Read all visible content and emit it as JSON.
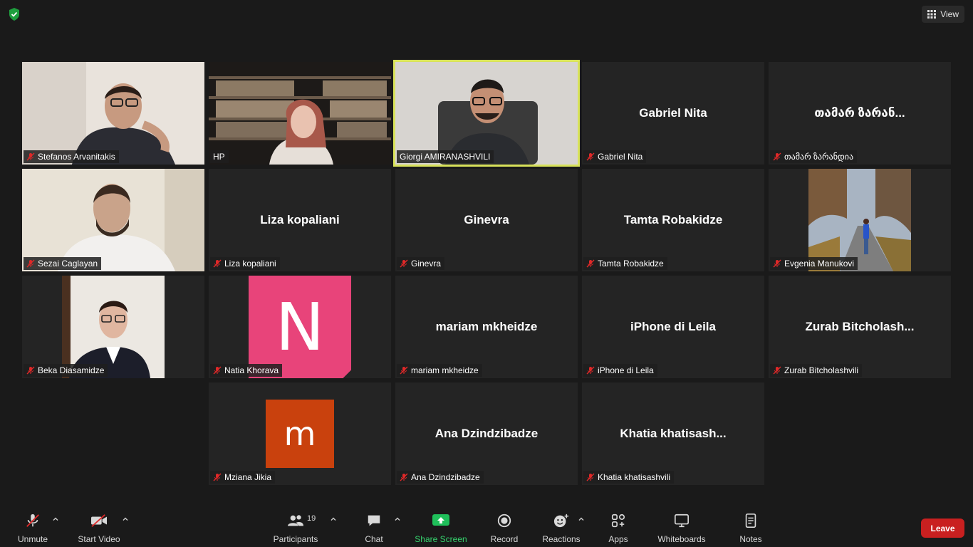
{
  "top": {
    "view_label": "View"
  },
  "tiles": [
    {
      "name": "Stefanos Arvanitakis"
    },
    {
      "name": "HP"
    },
    {
      "name": "Giorgi AMIRANASHVILI"
    },
    {
      "name": "Gabriel Nita",
      "center": "Gabriel Nita"
    },
    {
      "name": "თამარ ზარანდია",
      "center": "თამარ ზარან..."
    },
    {
      "name": "Sezai Caglayan"
    },
    {
      "name": "Liza kopaliani",
      "center": "Liza kopaliani"
    },
    {
      "name": "Ginevra",
      "center": "Ginevra"
    },
    {
      "name": "Tamta Robakidze",
      "center": "Tamta Robakidze"
    },
    {
      "name": "Evgenia Manukovi"
    },
    {
      "name": "Beka Diasamidze"
    },
    {
      "name": "Natia Khorava",
      "avatar": "N"
    },
    {
      "name": "mariam mkheidze",
      "center": "mariam mkheidze"
    },
    {
      "name": "iPhone di Leila",
      "center": "iPhone di Leila"
    },
    {
      "name": "Zurab Bitcholashvili",
      "center": "Zurab  Bitcholash..."
    },
    {
      "name": "Mziana Jikia",
      "avatar": "m"
    },
    {
      "name": "Ana Dzindzibadze",
      "center": "Ana Dzindzibadze"
    },
    {
      "name": "Khatia khatisashvili",
      "center": "Khatia  khatisash..."
    }
  ],
  "toolbar": {
    "unmute": "Unmute",
    "start_video": "Start Video",
    "participants": "Participants",
    "participants_count": "19",
    "chat": "Chat",
    "share_screen": "Share Screen",
    "record": "Record",
    "reactions": "Reactions",
    "apps": "Apps",
    "whiteboards": "Whiteboards",
    "notes": "Notes",
    "leave": "Leave"
  },
  "colors": {
    "share_green": "#36d36e",
    "leave_red": "#c92020",
    "active_speaker": "#d8e25a",
    "avatar_n": "#e8447a",
    "avatar_m": "#c9410d"
  }
}
